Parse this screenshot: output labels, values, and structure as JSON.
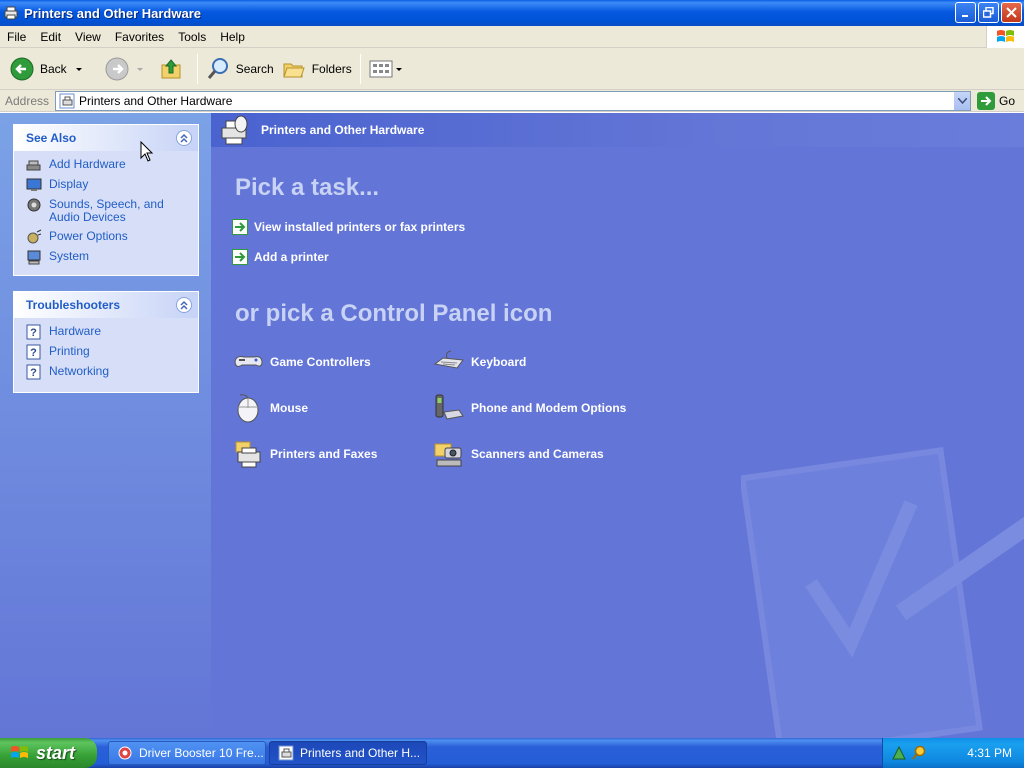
{
  "window": {
    "title": "Printers and Other Hardware"
  },
  "menu": [
    "File",
    "Edit",
    "View",
    "Favorites",
    "Tools",
    "Help"
  ],
  "toolbar": {
    "back_label": "Back",
    "search_label": "Search",
    "folders_label": "Folders"
  },
  "address": {
    "label": "Address",
    "value": "Printers and Other Hardware",
    "go_label": "Go"
  },
  "see_also": {
    "title": "See Also",
    "items": [
      {
        "label": "Add Hardware",
        "icon": "add-hardware-icon"
      },
      {
        "label": "Display",
        "icon": "display-icon"
      },
      {
        "label": "Sounds, Speech, and Audio Devices",
        "icon": "sounds-icon"
      },
      {
        "label": "Power Options",
        "icon": "power-options-icon"
      },
      {
        "label": "System",
        "icon": "system-icon"
      }
    ]
  },
  "troubleshooters": {
    "title": "Troubleshooters",
    "items": [
      {
        "label": "Hardware",
        "icon": "help-icon"
      },
      {
        "label": "Printing",
        "icon": "help-icon"
      },
      {
        "label": "Networking",
        "icon": "help-icon"
      }
    ]
  },
  "main": {
    "header": "Printers and Other Hardware",
    "pick_task": "Pick a task...",
    "tasks": [
      "View installed printers or fax printers",
      "Add a printer"
    ],
    "pick_icon": "or pick a Control Panel icon",
    "icons": [
      {
        "label": "Game Controllers",
        "icon": "game-controller-icon"
      },
      {
        "label": "Keyboard",
        "icon": "keyboard-icon"
      },
      {
        "label": "Mouse",
        "icon": "mouse-icon"
      },
      {
        "label": "Phone and Modem Options",
        "icon": "phone-modem-icon"
      },
      {
        "label": "Printers and Faxes",
        "icon": "printer-icon"
      },
      {
        "label": "Scanners and Cameras",
        "icon": "scanner-camera-icon"
      }
    ]
  },
  "taskbar": {
    "start_label": "start",
    "tasks": [
      {
        "label": "Driver Booster 10 Fre...",
        "active": false
      },
      {
        "label": "Printers and Other H...",
        "active": true
      }
    ],
    "clock": "4:31 PM"
  },
  "colors": {
    "link": "#215dc6",
    "pane_blue": "#6375d6",
    "title_blue": "#0052d6"
  }
}
